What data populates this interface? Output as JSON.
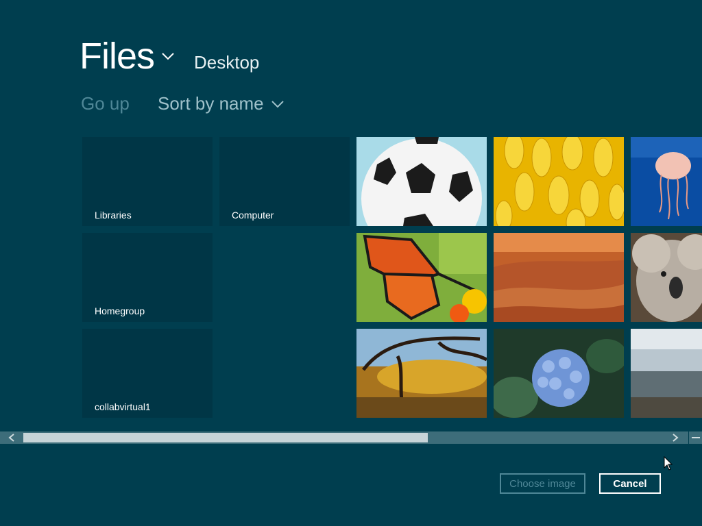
{
  "header": {
    "title": "Files",
    "location": "Desktop"
  },
  "toolbar": {
    "go_up_label": "Go up",
    "sort_label": "Sort by name"
  },
  "folders": [
    {
      "label": "Libraries"
    },
    {
      "label": "Computer"
    },
    {
      "label": "Homegroup"
    },
    {
      "label": "collabvirtual1"
    }
  ],
  "images": [
    {
      "subject": "soccer-ball"
    },
    {
      "subject": "yellow-chrysanthemum"
    },
    {
      "subject": "jellyfish"
    },
    {
      "subject": "butterfly"
    },
    {
      "subject": "desert"
    },
    {
      "subject": "koala"
    },
    {
      "subject": "autumn-tree"
    },
    {
      "subject": "hydrangea"
    },
    {
      "subject": "seascape"
    }
  ],
  "footer": {
    "choose_label": "Choose image",
    "cancel_label": "Cancel"
  },
  "scrollbar": {
    "position_fraction": 0.0,
    "visible_fraction": 0.6
  },
  "colors": {
    "background": "#003e4f",
    "tile": "#003646",
    "disabled_text": "#4f8797"
  }
}
